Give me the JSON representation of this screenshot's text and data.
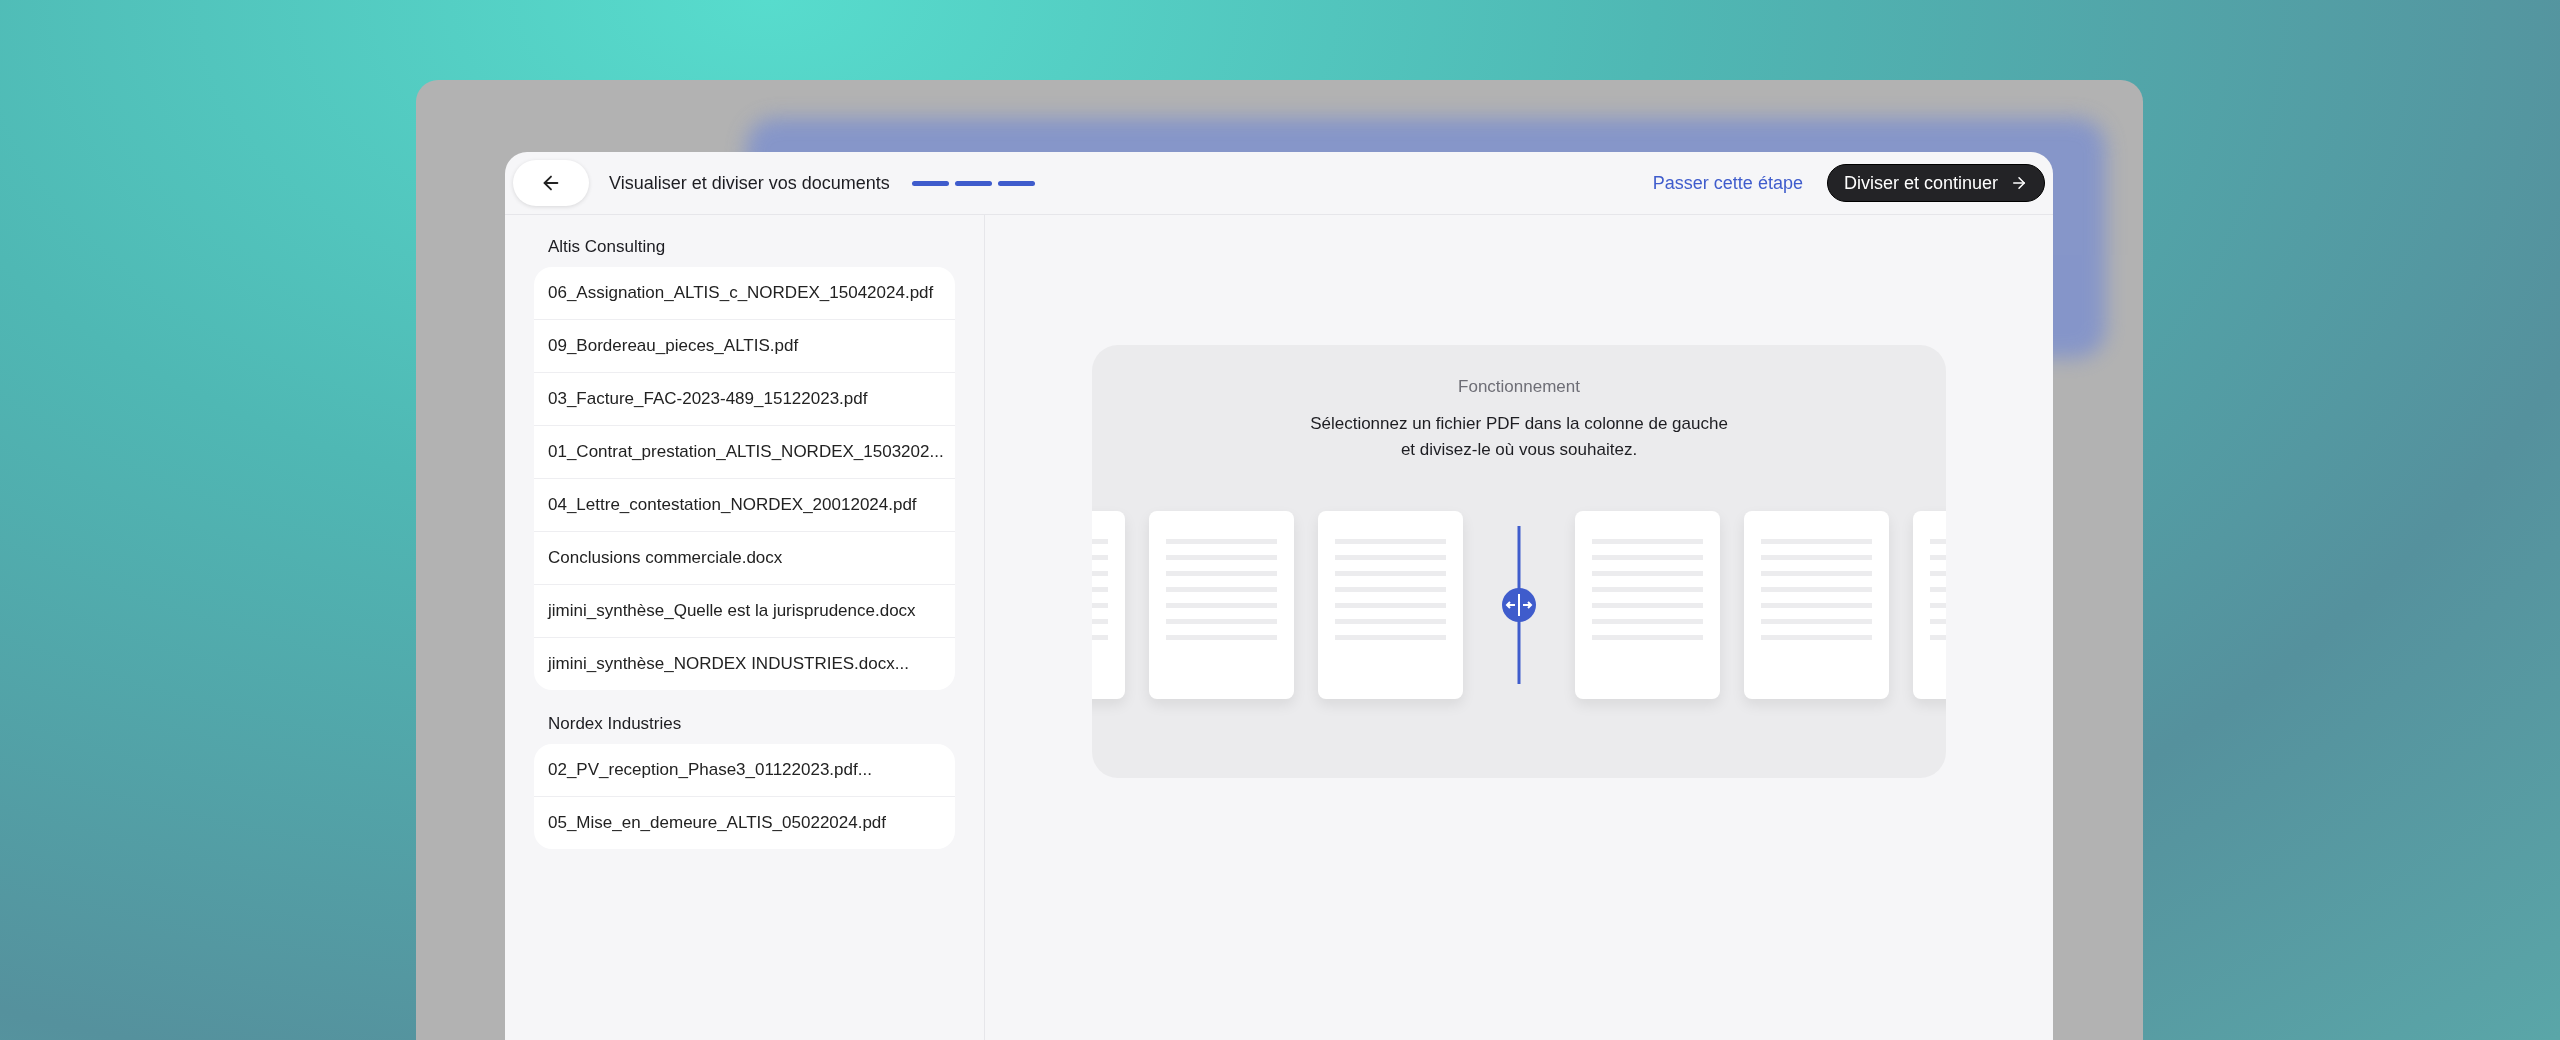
{
  "header": {
    "title": "Visualiser et diviser vos documents",
    "steps": [
      {
        "completed": true
      },
      {
        "completed": true
      },
      {
        "completed": true
      }
    ],
    "skip_link": "Passer cette étape",
    "primary_button": "Diviser et continuer"
  },
  "groups": [
    {
      "name": "Altis Consulting",
      "files": [
        "06_Assignation_ALTIS_c_NORDEX_15042024.pdf",
        "09_Bordereau_pieces_ALTIS.pdf",
        "03_Facture_FAC-2023-489_15122023.pdf",
        "01_Contrat_prestation_ALTIS_NORDEX_1503202...",
        "04_Lettre_contestation_NORDEX_20012024.pdf",
        "Conclusions commerciale.docx",
        "jimini_synthèse_Quelle est la jurisprudence.docx",
        "jimini_synthèse_NORDEX INDUSTRIES.docx..."
      ]
    },
    {
      "name": "Nordex Industries",
      "files": [
        "02_PV_reception_Phase3_01122023.pdf...",
        "05_Mise_en_demeure_ALTIS_05022024.pdf"
      ]
    }
  ],
  "how_it_works": {
    "title": "Fonctionnement",
    "text": "Sélectionnez un fichier PDF dans la colonne de gauche\net divisez-le où vous souhaitez."
  }
}
